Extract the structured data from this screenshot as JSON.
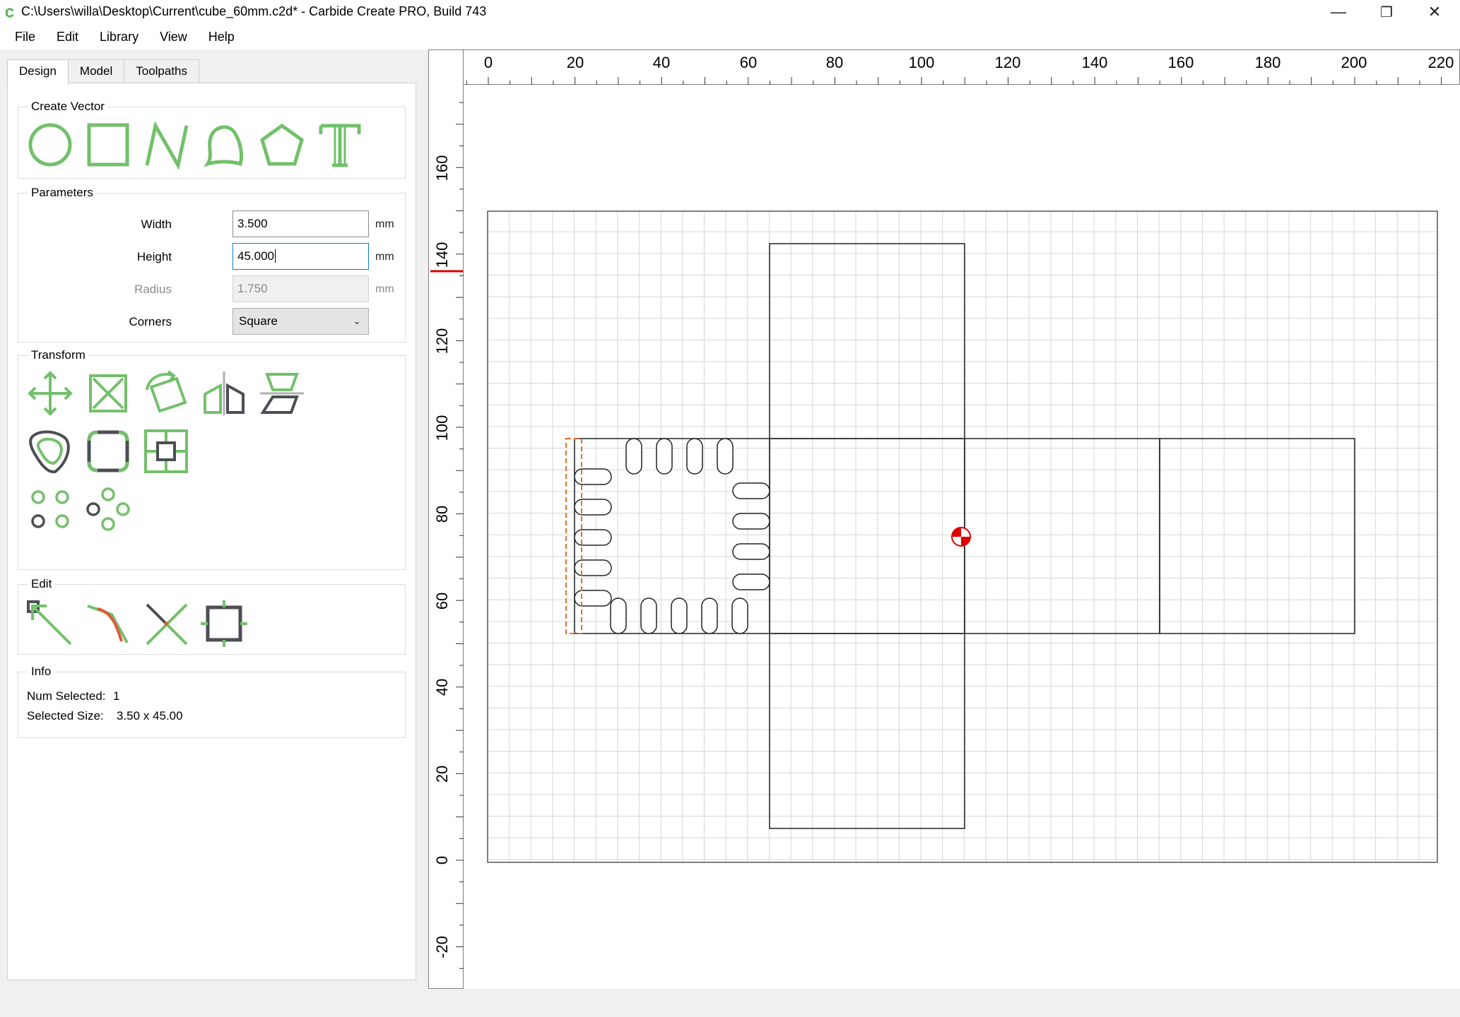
{
  "window": {
    "title": "C:\\Users\\willa\\Desktop\\Current\\cube_60mm.c2d* - Carbide Create PRO, Build 743",
    "controls": [
      "—",
      "❐",
      "✕"
    ]
  },
  "menu": [
    "File",
    "Edit",
    "Library",
    "View",
    "Help"
  ],
  "tabs": [
    {
      "label": "Design",
      "active": true
    },
    {
      "label": "Model",
      "active": false
    },
    {
      "label": "Toolpaths",
      "active": false
    }
  ],
  "create_vector": {
    "title": "Create Vector",
    "tools": [
      "circle-icon",
      "rectangle-icon",
      "polyline-icon",
      "curve-icon",
      "polygon-icon",
      "text-icon"
    ]
  },
  "parameters": {
    "title": "Parameters",
    "width": {
      "label": "Width",
      "value": "3.500",
      "unit": "mm"
    },
    "height": {
      "label": "Height",
      "value": "45.000",
      "unit": "mm"
    },
    "radius": {
      "label": "Radius",
      "value": "1.750",
      "unit": "mm"
    },
    "corners": {
      "label": "Corners",
      "value": "Square"
    }
  },
  "transform": {
    "title": "Transform",
    "tools": [
      "move-icon",
      "scale-icon",
      "rotate-icon",
      "mirror-icon",
      "align-icon",
      "offset-icon",
      "fillet-icon",
      "center-icon",
      "linear-array-icon",
      "circular-array-icon"
    ]
  },
  "edit": {
    "title": "Edit",
    "tools": [
      "node-edit-icon",
      "bezier-edit-icon",
      "trim-icon",
      "bounding-box-icon"
    ]
  },
  "info": {
    "title": "Info",
    "num_selected_label": "Num Selected:",
    "num_selected_value": "1",
    "size_label": "Selected Size:",
    "size_value": "3.50 x 45.00"
  },
  "rulers": {
    "x_labels": [
      "0",
      "20",
      "40",
      "60",
      "80",
      "100",
      "120",
      "140",
      "160",
      "180",
      "200",
      "220"
    ],
    "y_labels": [
      "-20",
      "0",
      "20",
      "40",
      "60",
      "80",
      "100",
      "120",
      "140",
      "160"
    ]
  },
  "colors": {
    "accent": "#73c06b",
    "dark_icon": "#4b4f54",
    "selection": "#e0702a",
    "origin_marker": "#e00000",
    "focus": "#0a7ad6"
  }
}
